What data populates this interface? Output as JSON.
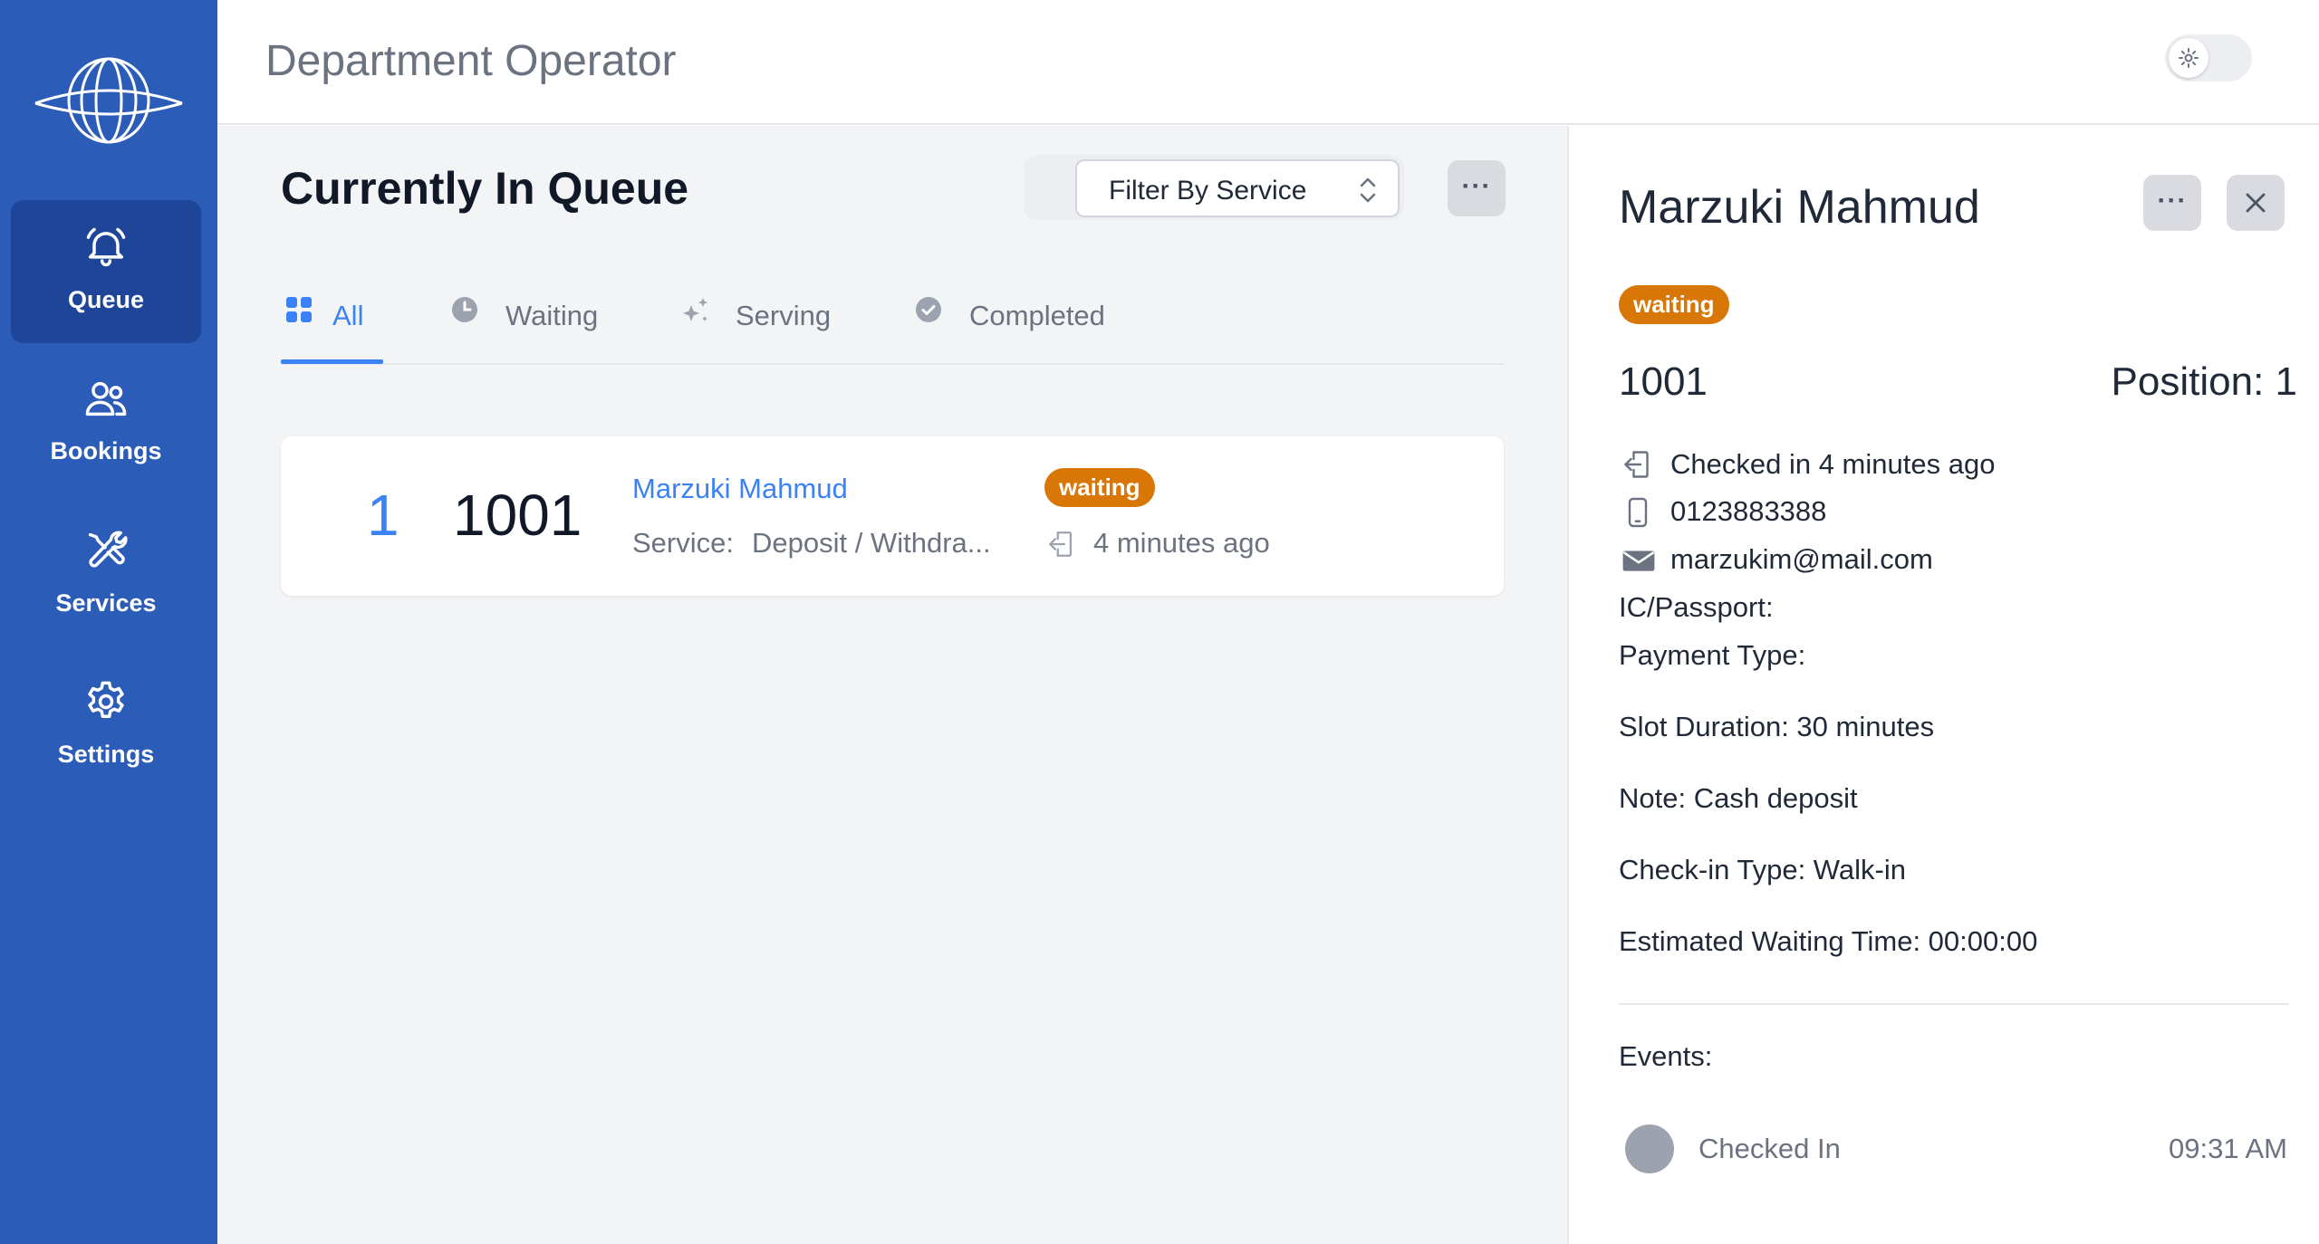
{
  "sidebar": {
    "logo_icon": "planet-logo-icon",
    "items": [
      {
        "label": "Queue",
        "icon": "bell-icon",
        "active": true
      },
      {
        "label": "Bookings",
        "icon": "users-icon",
        "active": false
      },
      {
        "label": "Services",
        "icon": "tools-icon",
        "active": false
      },
      {
        "label": "Settings",
        "icon": "gear-icon",
        "active": false
      }
    ]
  },
  "header": {
    "title": "Department Operator",
    "theme_toggle_icon": "sun-icon"
  },
  "main": {
    "title": "Currently In Queue",
    "filter": {
      "label": "Filter By Service"
    },
    "tabs": [
      {
        "label": "All",
        "icon": "grid-icon",
        "active": true
      },
      {
        "label": "Waiting",
        "icon": "clock-icon",
        "active": false
      },
      {
        "label": "Serving",
        "icon": "sparkles-icon",
        "active": false
      },
      {
        "label": "Completed",
        "icon": "check-circle-icon",
        "active": false
      }
    ],
    "queue": [
      {
        "position": "1",
        "ticket": "1001",
        "name": "Marzuki Mahmud",
        "service_label": "Service:",
        "service": "Deposit / Withdra...",
        "status": "waiting",
        "time": "4 minutes ago"
      }
    ]
  },
  "detail": {
    "name": "Marzuki Mahmud",
    "status": "waiting",
    "ticket": "1001",
    "position": "Position: 1",
    "checked_in": "Checked in 4 minutes ago",
    "phone": "0123883388",
    "email": "marzukim@mail.com",
    "ic_passport": "IC/Passport:",
    "payment_type": "Payment Type:",
    "slot_duration": "Slot Duration: 30 minutes",
    "note": "Note: Cash deposit",
    "checkin_type": "Check-in Type: Walk-in",
    "estimated_wait": "Estimated Waiting Time: 00:00:00",
    "events_label": "Events:",
    "events": [
      {
        "label": "Checked In",
        "time": "09:31 AM"
      }
    ]
  },
  "colors": {
    "sidebar": "#2b5cb8",
    "sidebar_active": "#1e4597",
    "accent": "#3b82f6",
    "waiting_badge": "#d97706"
  }
}
